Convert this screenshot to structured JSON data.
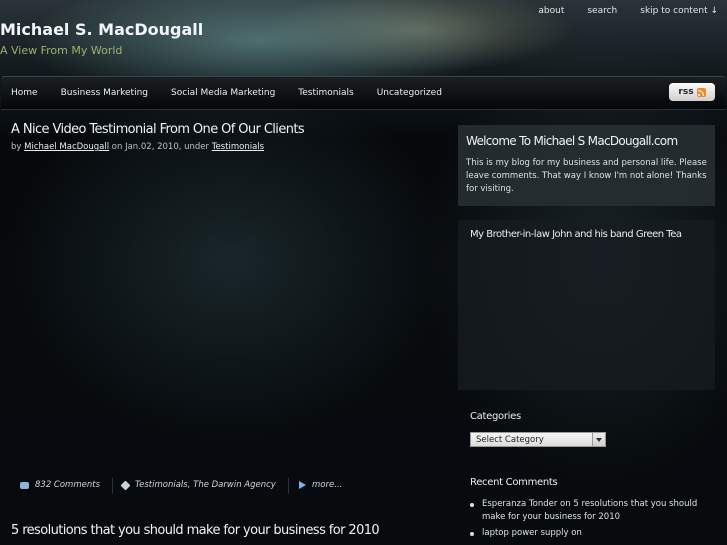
{
  "top_links": [
    "about",
    "search",
    "skip to content ↓"
  ],
  "site": {
    "title": "Michael S. MacDougall",
    "tagline": "A View From My World"
  },
  "nav": {
    "items": [
      "Home",
      "Business Marketing",
      "Social Media Marketing",
      "Testimonials",
      "Uncategorized"
    ],
    "rss_label": "rss"
  },
  "post": {
    "title": "A Nice Video Testimonial From One Of Our Clients",
    "by": "by",
    "author": "Michael MacDougall",
    "on": "on Jan.02, 2010, under",
    "category": "Testimonials",
    "footer": {
      "comments": "832 Comments",
      "tags": "Testimonials, The Darwin Agency",
      "more": "more..."
    }
  },
  "post2": {
    "title": "5 resolutions that you should make for your business for 2010"
  },
  "sidebar": {
    "welcome_title": "Welcome To Michael S MacDougall.com",
    "welcome_text": "This is my blog for my business and personal life. Please leave comments. That way I know I'm not alone! Thanks for visiting.",
    "video_title": "My Brother-in-law John and his band Green Tea",
    "categories_heading": "Categories",
    "categories_select": "Select Category",
    "recent_comments_heading": "Recent Comments",
    "recent_comments": [
      "Esperanza Tonder on 5 resolutions that you should make for your business for 2010",
      "laptop power supply on"
    ]
  }
}
